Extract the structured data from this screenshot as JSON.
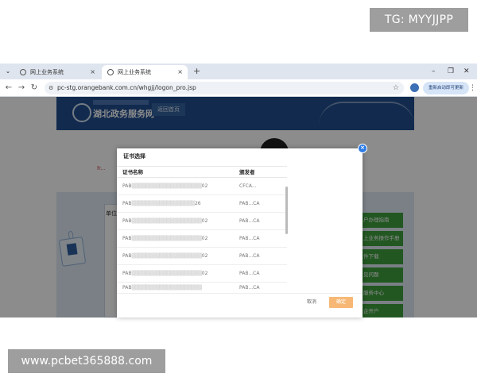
{
  "watermarks": {
    "top_right": "TG: MYYJJPP",
    "bottom_left": "www.pcbet365888.com"
  },
  "browser": {
    "tabs": [
      {
        "title": "网上业务系统",
        "active": false,
        "icon": "globe-icon"
      },
      {
        "title": "网上业务系统",
        "active": true,
        "icon": "globe-icon"
      }
    ],
    "url": "pc-stg.orangebank.com.cn/whgjj/logon_pro.jsp",
    "update_button": "重新启动即可更新"
  },
  "site": {
    "name": "湖北政务服务网",
    "home_link": "返回首页",
    "unit_label": "单位",
    "red_text": "fr...",
    "side_links": [
      "户办理指南",
      "上业务操作手册",
      "件下载",
      "见问题",
      "服务中心",
      "企开户"
    ]
  },
  "dialog": {
    "title": "证书选择",
    "columns": {
      "name": "证书名称",
      "issuer": "颁发者"
    },
    "rows": [
      {
        "name_prefix": "PAB",
        "name_suffix": "02",
        "issuer": "CFCA..."
      },
      {
        "name_prefix": "PAB",
        "name_suffix": "26",
        "issuer": "PAB...CA"
      },
      {
        "name_prefix": "PAB",
        "name_suffix": "02",
        "issuer": "PAB...CA"
      },
      {
        "name_prefix": "PAB",
        "name_suffix": "02",
        "issuer": "PAB...CA"
      },
      {
        "name_prefix": "PAB",
        "name_suffix": "02",
        "issuer": "PAB...CA"
      },
      {
        "name_prefix": "PAB",
        "name_suffix": "02",
        "issuer": "PAB...CA"
      },
      {
        "name_prefix": "PAB",
        "name_suffix": "",
        "issuer": "PAB...CA"
      }
    ],
    "cancel_label": "取消",
    "ok_label": "确定"
  },
  "colors": {
    "ok_button": "#f7b876",
    "close_button": "#2c7be5",
    "header_blue": "#1f4e8f",
    "side_green": "#3f9f3f"
  }
}
